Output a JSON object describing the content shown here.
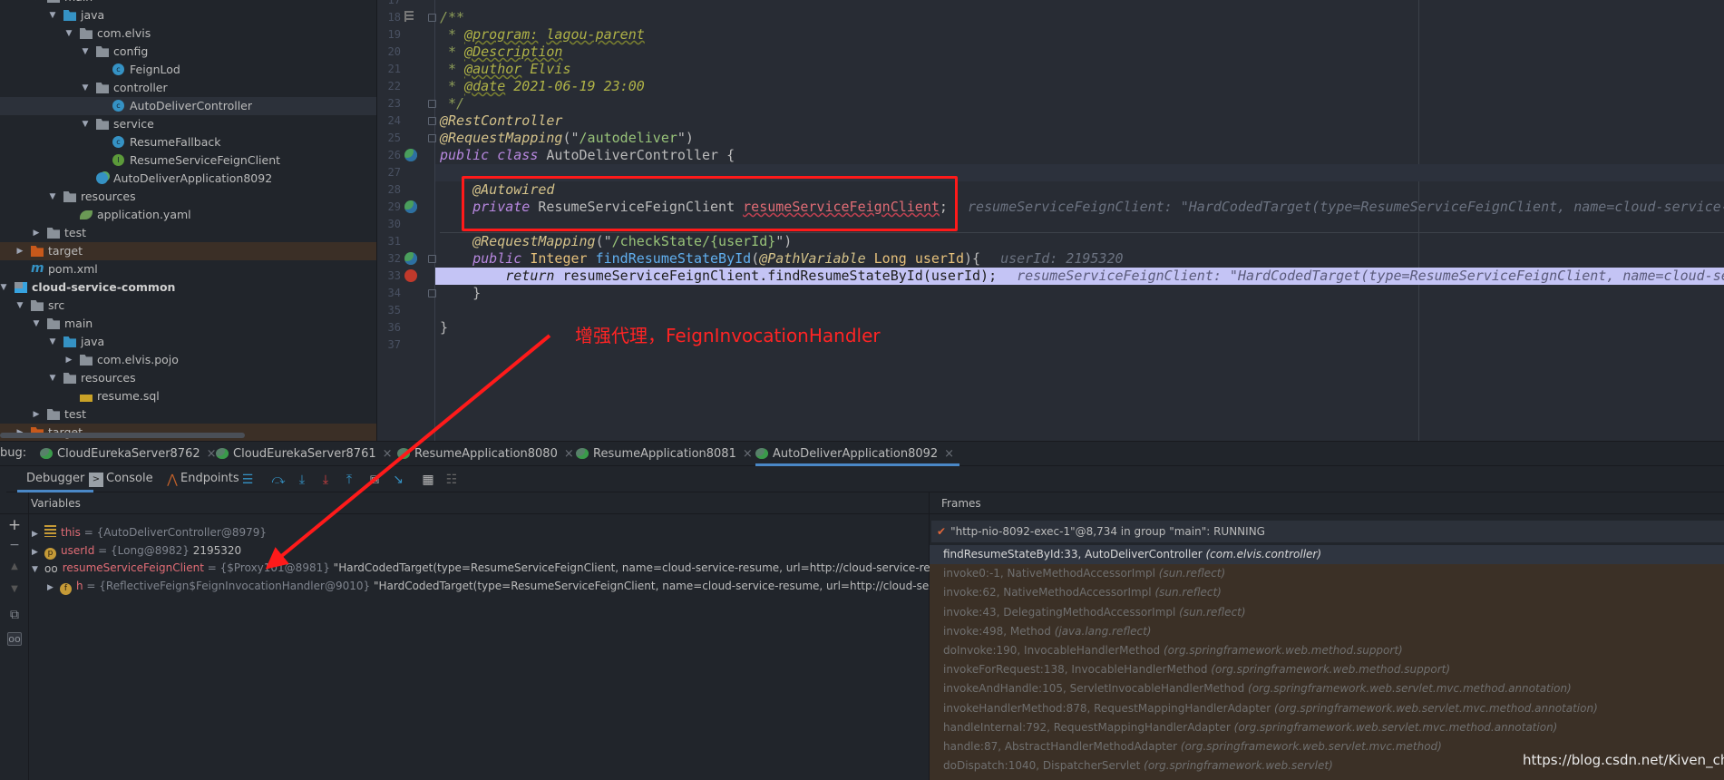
{
  "project_tree": [
    {
      "label": "main",
      "depth": 2,
      "kind": "folder",
      "state": "open"
    },
    {
      "label": "java",
      "depth": 3,
      "kind": "src",
      "state": "open"
    },
    {
      "label": "com.elvis",
      "depth": 4,
      "kind": "folder",
      "state": "open"
    },
    {
      "label": "config",
      "depth": 5,
      "kind": "folder",
      "state": "open"
    },
    {
      "label": "FeignLod",
      "depth": 6,
      "kind": "cls",
      "state": "leaf"
    },
    {
      "label": "controller",
      "depth": 5,
      "kind": "folder",
      "state": "open"
    },
    {
      "label": "AutoDeliverController",
      "depth": 6,
      "kind": "cls",
      "state": "leaf",
      "selected": true
    },
    {
      "label": "service",
      "depth": 5,
      "kind": "folder",
      "state": "open"
    },
    {
      "label": "ResumeFallback",
      "depth": 6,
      "kind": "cls",
      "state": "leaf"
    },
    {
      "label": "ResumeServiceFeignClient",
      "depth": 6,
      "kind": "intf",
      "state": "leaf"
    },
    {
      "label": "AutoDeliverApplication8092",
      "depth": 5,
      "kind": "app",
      "state": "leaf"
    },
    {
      "label": "resources",
      "depth": 3,
      "kind": "folder",
      "state": "open"
    },
    {
      "label": "application.yaml",
      "depth": 4,
      "kind": "yaml",
      "state": "leaf"
    },
    {
      "label": "test",
      "depth": 2,
      "kind": "folder",
      "state": "closed"
    },
    {
      "label": "target",
      "depth": 1,
      "kind": "target",
      "state": "closed",
      "excluded": true
    },
    {
      "label": "pom.xml",
      "depth": 1,
      "kind": "maven",
      "state": "leaf"
    },
    {
      "label": "cloud-service-common",
      "depth": 0,
      "kind": "module",
      "state": "open",
      "bold": true
    },
    {
      "label": "src",
      "depth": 1,
      "kind": "folder",
      "state": "open"
    },
    {
      "label": "main",
      "depth": 2,
      "kind": "folder",
      "state": "open"
    },
    {
      "label": "java",
      "depth": 3,
      "kind": "src",
      "state": "open"
    },
    {
      "label": "com.elvis.pojo",
      "depth": 4,
      "kind": "folder",
      "state": "closed"
    },
    {
      "label": "resources",
      "depth": 3,
      "kind": "folder",
      "state": "open"
    },
    {
      "label": "resume.sql",
      "depth": 4,
      "kind": "sql",
      "state": "leaf"
    },
    {
      "label": "test",
      "depth": 2,
      "kind": "folder",
      "state": "closed"
    },
    {
      "label": "target",
      "depth": 1,
      "kind": "target",
      "state": "closed",
      "excluded": true
    }
  ],
  "editor": {
    "first_line": 17,
    "current_line": 27,
    "execution_line": 33,
    "lines": [
      {
        "n": 17,
        "tokens": []
      },
      {
        "n": 18,
        "icon": "structure",
        "fold": true,
        "tokens": [
          {
            "c": "cm",
            "t": "/**"
          }
        ]
      },
      {
        "n": 19,
        "tokens": [
          {
            "c": "cm",
            "t": " * "
          },
          {
            "c": "doctag",
            "t": "@program:"
          },
          {
            "c": "docval",
            "t": " "
          },
          {
            "c": "doctag",
            "t": "lagou-parent"
          }
        ]
      },
      {
        "n": 20,
        "tokens": [
          {
            "c": "cm",
            "t": " * "
          },
          {
            "c": "doctag",
            "t": "@Description"
          }
        ]
      },
      {
        "n": 21,
        "tokens": [
          {
            "c": "cm",
            "t": " * "
          },
          {
            "c": "doctag",
            "t": "@author"
          },
          {
            "c": "docval",
            "t": " Elvis"
          }
        ]
      },
      {
        "n": 22,
        "tokens": [
          {
            "c": "cm",
            "t": " * "
          },
          {
            "c": "doctag",
            "t": "@date"
          },
          {
            "c": "docval",
            "t": " 2021-06-19 23:00"
          }
        ]
      },
      {
        "n": 23,
        "fold": true,
        "tokens": [
          {
            "c": "cm",
            "t": " */"
          }
        ]
      },
      {
        "n": 24,
        "fold": true,
        "tokens": [
          {
            "c": "ann",
            "t": "@RestController"
          }
        ]
      },
      {
        "n": 25,
        "fold": true,
        "tokens": [
          {
            "c": "ann",
            "t": "@RequestMapping"
          },
          {
            "c": "p",
            "t": "(\""
          },
          {
            "c": "str",
            "t": "/autodeliver"
          },
          {
            "c": "p",
            "t": "\")"
          }
        ]
      },
      {
        "n": 26,
        "icon": "bean",
        "tokens": [
          {
            "c": "kw",
            "t": "public"
          },
          {
            "c": "p",
            "t": " "
          },
          {
            "c": "kw",
            "t": "class"
          },
          {
            "c": "p",
            "t": " AutoDeliverController {"
          }
        ]
      },
      {
        "n": 27,
        "tokens": []
      },
      {
        "n": 28,
        "tokens": [
          {
            "c": "p",
            "t": "    "
          },
          {
            "c": "ann",
            "t": "@Autowired"
          }
        ]
      },
      {
        "n": 29,
        "icon": "bean",
        "tokens": [
          {
            "c": "p",
            "t": "    "
          },
          {
            "c": "kw",
            "t": "private"
          },
          {
            "c": "p",
            "t": " ResumeServiceFeignClient "
          },
          {
            "c": "field",
            "t": "resumeServiceFeignClient"
          },
          {
            "c": "p",
            "t": ";"
          },
          {
            "c": "hint",
            "t": "resumeServiceFeignClient: \"HardCodedTarget(type=ResumeServiceFeignClient, name=cloud-service-r"
          }
        ]
      },
      {
        "n": 30,
        "tokens": []
      },
      {
        "n": 31,
        "tokens": [
          {
            "c": "p",
            "t": "    "
          },
          {
            "c": "ann",
            "t": "@RequestMapping"
          },
          {
            "c": "p",
            "t": "(\""
          },
          {
            "c": "str",
            "t": "/checkState/{userId}"
          },
          {
            "c": "p",
            "t": "\")"
          }
        ]
      },
      {
        "n": 32,
        "icon": "bean",
        "fold": true,
        "tokens": [
          {
            "c": "p",
            "t": "    "
          },
          {
            "c": "kw",
            "t": "public"
          },
          {
            "c": "p",
            "t": " "
          },
          {
            "c": "type",
            "t": "Integer"
          },
          {
            "c": "p",
            "t": " "
          },
          {
            "c": "fn",
            "t": "findResumeStateById"
          },
          {
            "c": "p",
            "t": "("
          },
          {
            "c": "ann",
            "t": "@PathVariable"
          },
          {
            "c": "p",
            "t": " "
          },
          {
            "c": "type",
            "t": "Long"
          },
          {
            "c": "p",
            "t": " "
          },
          {
            "c": "param",
            "t": "userId"
          },
          {
            "c": "p",
            "t": "){"
          },
          {
            "c": "hint",
            "t": "userId: 2195320"
          }
        ]
      },
      {
        "n": 33,
        "icon": "breakpoint",
        "tokens": [
          {
            "c": "p",
            "t": "        "
          },
          {
            "c": "ret",
            "t": "return"
          },
          {
            "c": "p",
            "t": " resumeServiceFeignClient.findResumeStateById(userId);"
          },
          {
            "c": "hint",
            "t": "resumeServiceFeignClient: \"HardCodedTarget(type=ResumeServiceFeignClient, name=cloud-ser"
          }
        ]
      },
      {
        "n": 34,
        "fold": true,
        "tokens": [
          {
            "c": "p",
            "t": "    }"
          }
        ]
      },
      {
        "n": 35,
        "tokens": []
      },
      {
        "n": 36,
        "tokens": [
          {
            "c": "p",
            "t": "}"
          }
        ]
      },
      {
        "n": 37,
        "tokens": []
      }
    ]
  },
  "annotation": {
    "text": "增强代理，FeignInvocationHandler",
    "color": "#ff2424"
  },
  "debug": {
    "label": "bug:",
    "tabs": [
      {
        "label": "CloudEurekaServer8762"
      },
      {
        "label": "CloudEurekaServer8761"
      },
      {
        "label": "ResumeApplication8080"
      },
      {
        "label": "ResumeApplication8081"
      },
      {
        "label": "AutoDeliverApplication8092",
        "active": true
      }
    ],
    "close_glyph": "×",
    "toolbar": {
      "debugger": "Debugger",
      "console": "Console",
      "endpoints": "Endpoints"
    },
    "variables_title": "Variables",
    "variables": [
      {
        "arrow": "▶",
        "icon": "lines",
        "badge": "",
        "name": "this",
        "type": " = {AutoDeliverController@8979}",
        "value": ""
      },
      {
        "arrow": "▶",
        "icon": "param",
        "badge": "p",
        "name": "userId",
        "type": " = {Long@8982}",
        "value": " 2195320"
      },
      {
        "arrow": "▼",
        "icon": "oo",
        "badge": "oo",
        "name": "resumeServiceFeignClient",
        "type": " = {$Proxy101@8981}",
        "value": " \"HardCodedTarget(type=ResumeServiceFeignClient, name=cloud-service-resume, url=http://cloud-service-resume/re"
      },
      {
        "arrow": "▶",
        "icon": "field",
        "badge": "f",
        "name": "h",
        "type": " = {ReflectiveFeign$FeignInvocationHandler@9010}",
        "value": " \"HardCodedTarget(type=ResumeServiceFeignClient, name=cloud-service-resume, url=http://cloud-service-re",
        "child": true
      }
    ],
    "frames_title": "Frames",
    "thread": "\"http-nio-8092-exec-1\"@8,734 in group \"main\": RUNNING",
    "frames": [
      {
        "m": "findResumeStateById:33, AutoDeliverController ",
        "p": "(com.elvis.controller)",
        "selected": true
      },
      {
        "m": "invoke0:-1, NativeMethodAccessorImpl ",
        "p": "(sun.reflect)"
      },
      {
        "m": "invoke:62, NativeMethodAccessorImpl ",
        "p": "(sun.reflect)"
      },
      {
        "m": "invoke:43, DelegatingMethodAccessorImpl ",
        "p": "(sun.reflect)"
      },
      {
        "m": "invoke:498, Method ",
        "p": "(java.lang.reflect)"
      },
      {
        "m": "doInvoke:190, InvocableHandlerMethod ",
        "p": "(org.springframework.web.method.support)"
      },
      {
        "m": "invokeForRequest:138, InvocableHandlerMethod ",
        "p": "(org.springframework.web.method.support)"
      },
      {
        "m": "invokeAndHandle:105, ServletInvocableHandlerMethod ",
        "p": "(org.springframework.web.servlet.mvc.method.annotation)"
      },
      {
        "m": "invokeHandlerMethod:878, RequestMappingHandlerAdapter ",
        "p": "(org.springframework.web.servlet.mvc.method.annotation)"
      },
      {
        "m": "handleInternal:792, RequestMappingHandlerAdapter ",
        "p": "(org.springframework.web.servlet.mvc.method.annotation)"
      },
      {
        "m": "handle:87, AbstractHandlerMethodAdapter ",
        "p": "(org.springframework.web.servlet.mvc.method)"
      },
      {
        "m": "doDispatch:1040, DispatcherServlet ",
        "p": "(org.springframework.web.servlet)"
      }
    ]
  },
  "watermark": "https://blog.csdn.net/Kiven_ch",
  "colors": {
    "annotation_red": "#ff1a1a",
    "exec_line": "#c4c4f5",
    "frames_bg": "#3b3026",
    "accent": "#4a88c7"
  }
}
